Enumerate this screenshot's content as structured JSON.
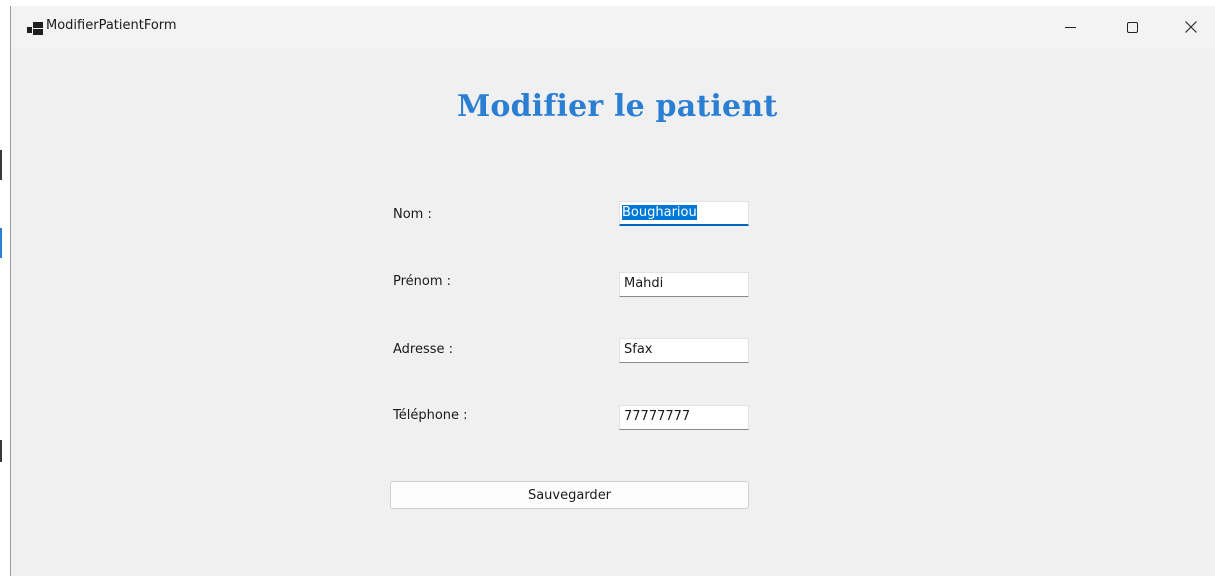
{
  "window": {
    "title": "ModifierPatientForm",
    "controls": [
      "minimize",
      "maximize",
      "close"
    ]
  },
  "form": {
    "heading": "Modifier le patient",
    "heading_color": "#2b7fd3",
    "fields": [
      {
        "label": "Nom :",
        "value": "Boughariou",
        "focused": true,
        "selected": true
      },
      {
        "label": "Prénom :",
        "value": "Mahdi"
      },
      {
        "label": "Adresse :",
        "value": "Sfax"
      },
      {
        "label": "Téléphone :",
        "value": "77777777"
      }
    ],
    "save_label": "Sauvegarder"
  },
  "icons": {
    "app": "app-icon",
    "minimize": "minimize-icon",
    "maximize": "maximize-icon",
    "close": "close-icon"
  },
  "colors": {
    "focus_accent": "#0067c0",
    "selection": "#0078d7",
    "window_bg": "#f0f0f0"
  }
}
